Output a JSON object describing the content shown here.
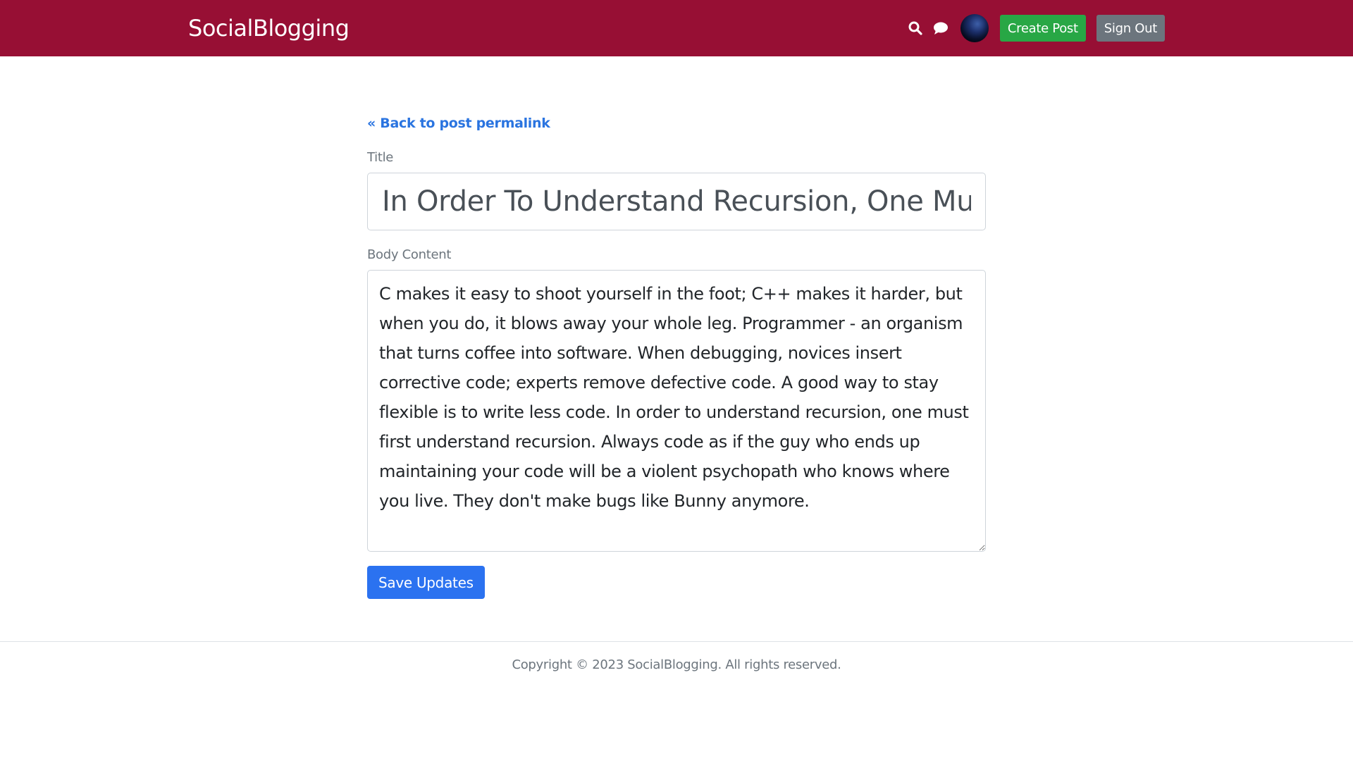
{
  "header": {
    "brand": "SocialBlogging",
    "search_icon": "search-icon",
    "chat_icon": "chat-icon",
    "create_post_label": "Create Post",
    "sign_out_label": "Sign Out"
  },
  "main": {
    "back_link": "« Back to post permalink",
    "title_label": "Title",
    "title_value": "In Order To Understand Recursion, One Must First Understand Recursion",
    "body_label": "Body Content",
    "body_value": "C makes it easy to shoot yourself in the foot; C++ makes it harder, but when you do, it blows away your whole leg. Programmer - an organism that turns coffee into software. When debugging, novices insert corrective code; experts remove defective code. A good way to stay flexible is to write less code. In order to understand recursion, one must first understand recursion. Always code as if the guy who ends up maintaining your code will be a violent psychopath who knows where you live. They don't make bugs like Bunny anymore.",
    "save_label": "Save Updates"
  },
  "footer": {
    "copyright": "Copyright © 2023 SocialBlogging. All rights reserved."
  },
  "colors": {
    "navbar": "#970f34",
    "success": "#28a745",
    "secondary": "#6c757d",
    "primary": "#2b72f0",
    "link": "#2a74e0"
  }
}
